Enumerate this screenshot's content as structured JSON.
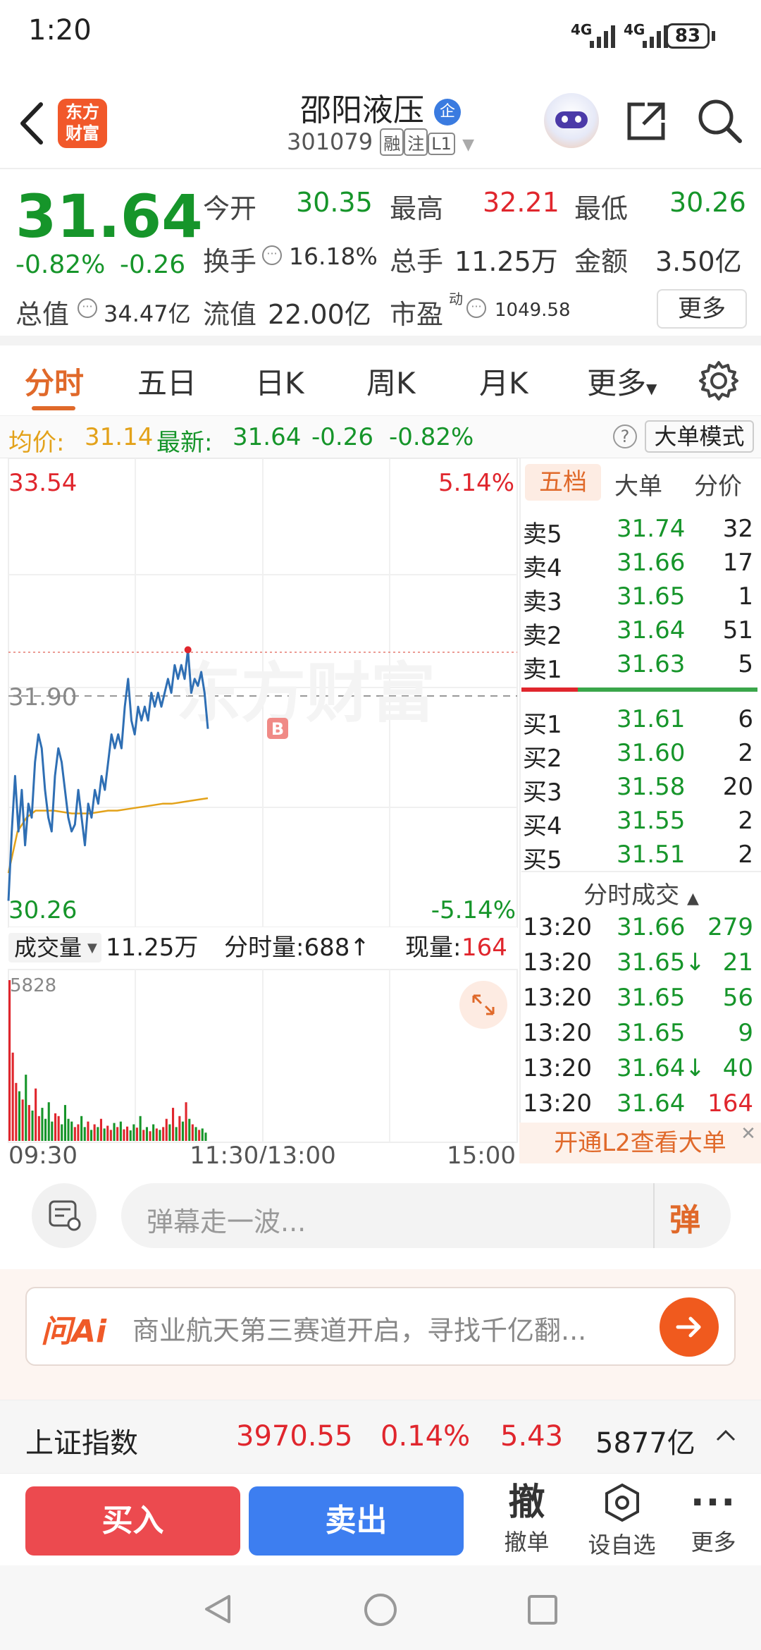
{
  "status_bar": {
    "time": "1:20",
    "net1": "4G",
    "net2": "4G",
    "battery": "83"
  },
  "header": {
    "brand_line1": "东方",
    "brand_line2": "财富",
    "stock_name": "邵阳液压",
    "name_badge": "企",
    "stock_code": "301079",
    "tag1": "融",
    "tag2": "注",
    "tag3": "L1"
  },
  "quote": {
    "price": "31.64",
    "change_pct": "-0.82%",
    "change_abs": "-0.26",
    "open_label": "今开",
    "open_value": "30.35",
    "high_label": "最高",
    "high_value": "32.21",
    "low_label": "最低",
    "low_value": "30.26",
    "turnover_label": "换手",
    "turnover_value": "16.18%",
    "volume_label": "总手",
    "volume_value": "11.25万",
    "amount_label": "金额",
    "amount_value": "3.50亿",
    "mktcap_label": "总值",
    "mktcap_value": "34.47亿",
    "float_label": "流值",
    "float_value": "22.00亿",
    "pe_label": "市盈",
    "pe_sup": "动",
    "pe_value": "1049.58",
    "more_button": "更多"
  },
  "tabs": {
    "items": [
      "分时",
      "五日",
      "日K",
      "周K",
      "月K",
      "更多"
    ],
    "active": 0
  },
  "avg_bar": {
    "avg_label": "均价:",
    "avg_value": "31.14",
    "latest_label": "最新:",
    "latest_value": "31.64",
    "chg": "-0.26",
    "chg_pct": "-0.82%",
    "help": "?",
    "big_order_mode": "大单模式"
  },
  "chart": {
    "y_max": "33.54",
    "y_min": "30.26",
    "pct_max": "5.14%",
    "pct_min": "-5.14%",
    "ref_price": "31.90",
    "watermark": "东方财富",
    "buy_marker": "B",
    "volume_label": "成交量",
    "volume_value": "11.25万",
    "minute_volume": "分时量:688↑",
    "current_volume_label": "现量:",
    "current_volume_value": "164",
    "vol_max": "5828",
    "time_start": "09:30",
    "time_mid": "11:30/13:00",
    "time_end": "15:00"
  },
  "chart_data": {
    "type": "line",
    "title": "",
    "ylim": [
      30.26,
      33.54
    ],
    "prev_close": 31.9,
    "x_range": [
      "09:30",
      "15:00"
    ],
    "series": [
      {
        "name": "price",
        "values": [
          30.4,
          30.9,
          31.3,
          30.9,
          31.2,
          30.8,
          31.1,
          31.0,
          31.4,
          31.6,
          31.5,
          31.2,
          31.0,
          30.9,
          31.3,
          31.5,
          31.4,
          31.2,
          31.0,
          30.9,
          30.95,
          31.2,
          31.0,
          30.8,
          31.1,
          31.0,
          31.2,
          31.1,
          31.3,
          31.2,
          31.4,
          31.6,
          31.5,
          31.6,
          31.5,
          31.8,
          32.0,
          31.7,
          31.6,
          31.8,
          31.7,
          31.8,
          31.7,
          31.9,
          31.8,
          31.9,
          31.8,
          31.9,
          32.0,
          31.9,
          32.1,
          32.0,
          32.1,
          32.0,
          32.21,
          31.9,
          32.0,
          31.95,
          32.05,
          31.9,
          31.64
        ]
      },
      {
        "name": "avg",
        "values": [
          30.6,
          30.9,
          31.0,
          31.05,
          31.05,
          31.05,
          31.04,
          31.03,
          31.03,
          31.03,
          31.04,
          31.05,
          31.05,
          31.06,
          31.07,
          31.08,
          31.09,
          31.1,
          31.1,
          31.11,
          31.12,
          31.13,
          31.14
        ]
      }
    ],
    "volume": {
      "max": 5828,
      "bars": [
        5828,
        3200,
        2100,
        1800,
        1500,
        2400,
        1300,
        1100,
        1900,
        900,
        1200,
        800,
        1400,
        700,
        1000,
        900,
        600,
        1300,
        800,
        700,
        500,
        600,
        900,
        500,
        700,
        400,
        600,
        500,
        800,
        450,
        550,
        400,
        650,
        500,
        700,
        420,
        520,
        380,
        600,
        480,
        900,
        400,
        500,
        350,
        600,
        450,
        400,
        500,
        800,
        600,
        1200,
        500,
        900,
        700,
        1400,
        800,
        600,
        500,
        400,
        450,
        300
      ]
    }
  },
  "order_book": {
    "tab_active": "五档",
    "tab2": "大单",
    "tab3": "分价",
    "asks": [
      {
        "label": "卖5",
        "price": "31.74",
        "qty": "32"
      },
      {
        "label": "卖4",
        "price": "31.66",
        "qty": "17"
      },
      {
        "label": "卖3",
        "price": "31.65",
        "qty": "1"
      },
      {
        "label": "卖2",
        "price": "31.64",
        "qty": "51"
      },
      {
        "label": "卖1",
        "price": "31.63",
        "qty": "5"
      }
    ],
    "bids": [
      {
        "label": "买1",
        "price": "31.61",
        "qty": "6"
      },
      {
        "label": "买2",
        "price": "31.60",
        "qty": "2"
      },
      {
        "label": "买3",
        "price": "31.58",
        "qty": "20"
      },
      {
        "label": "买4",
        "price": "31.55",
        "qty": "2"
      },
      {
        "label": "买5",
        "price": "31.51",
        "qty": "2"
      }
    ],
    "ticks_title": "分时成交",
    "ticks": [
      {
        "time": "13:20",
        "price": "31.66",
        "qty": "279"
      },
      {
        "time": "13:20",
        "price": "31.65↓",
        "qty": "21"
      },
      {
        "time": "13:20",
        "price": "31.65",
        "qty": "56"
      },
      {
        "time": "13:20",
        "price": "31.65",
        "qty": "9"
      },
      {
        "time": "13:20",
        "price": "31.64↓",
        "qty": "40"
      },
      {
        "time": "13:20",
        "price": "31.64",
        "qty": "164"
      }
    ],
    "l2_promo": "开通L2查看大单"
  },
  "danmu": {
    "placeholder": "弹幕走一波...",
    "button": "弹"
  },
  "ai": {
    "logo": "问Ai",
    "text": "商业航天第三赛道开启，寻找千亿翻..."
  },
  "index_bar": {
    "name": "上证指数",
    "value": "3970.55",
    "pct": "0.14%",
    "chg": "5.43",
    "amount": "5877亿"
  },
  "bottom_bar": {
    "buy": "买入",
    "sell": "卖出",
    "cancel_icon": "撤",
    "cancel_label": "撤单",
    "watch_label": "设自选",
    "more_label": "更多"
  },
  "colors": {
    "red": "#e0262d",
    "green": "#16952a",
    "orange": "#e0692a",
    "blue": "#2f6fb4",
    "avg_line": "#e3a21a"
  }
}
